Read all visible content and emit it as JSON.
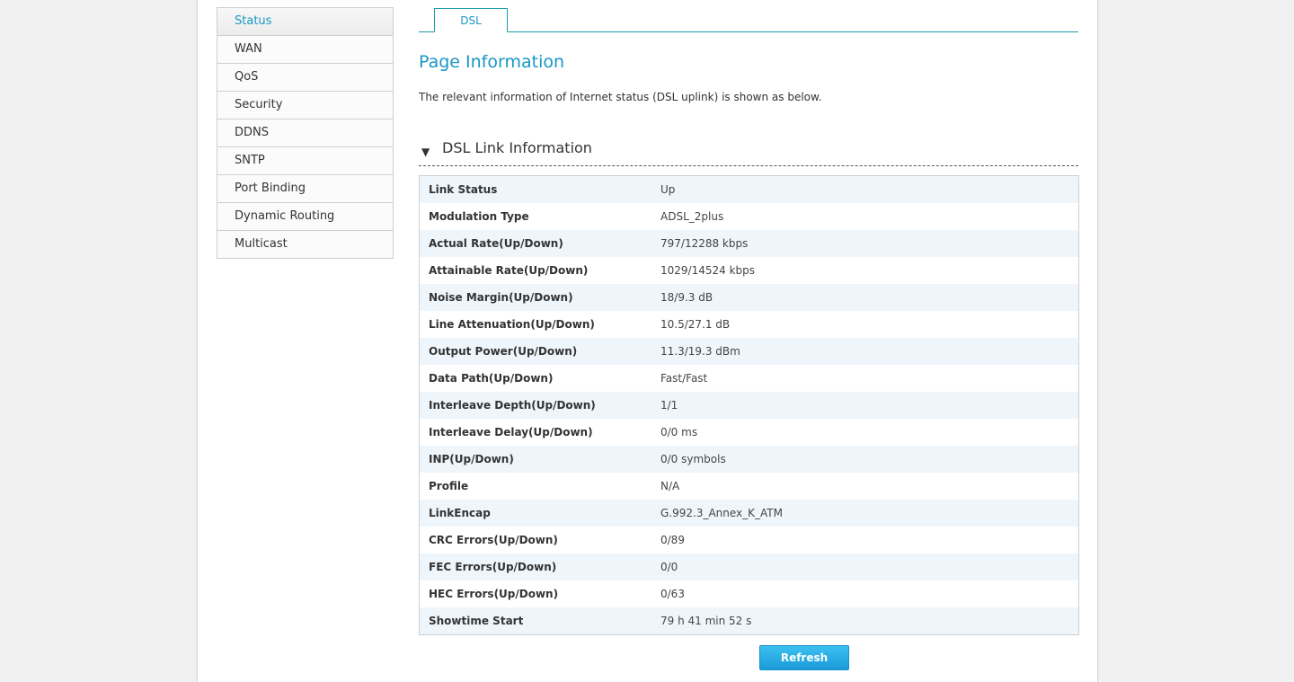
{
  "sidebar": {
    "items": [
      {
        "label": "Status",
        "active": true
      },
      {
        "label": "WAN"
      },
      {
        "label": "QoS"
      },
      {
        "label": "Security"
      },
      {
        "label": "DDNS"
      },
      {
        "label": "SNTP"
      },
      {
        "label": "Port Binding"
      },
      {
        "label": "Dynamic Routing"
      },
      {
        "label": "Multicast"
      }
    ]
  },
  "tabs": [
    {
      "label": "DSL",
      "active": true
    }
  ],
  "main": {
    "page_title": "Page Information",
    "description": "The relevant information of Internet status (DSL uplink) is shown as below.",
    "section_title": "DSL Link Information",
    "section_icon": "triangle-down-icon",
    "rows": [
      {
        "label": "Link Status",
        "value": "Up"
      },
      {
        "label": "Modulation Type",
        "value": "ADSL_2plus"
      },
      {
        "label": "Actual Rate(Up/Down)",
        "value": "797/12288 kbps"
      },
      {
        "label": "Attainable Rate(Up/Down)",
        "value": "1029/14524 kbps"
      },
      {
        "label": "Noise Margin(Up/Down)",
        "value": "18/9.3 dB"
      },
      {
        "label": "Line Attenuation(Up/Down)",
        "value": "10.5/27.1 dB"
      },
      {
        "label": "Output Power(Up/Down)",
        "value": "11.3/19.3 dBm"
      },
      {
        "label": "Data Path(Up/Down)",
        "value": "Fast/Fast"
      },
      {
        "label": "Interleave Depth(Up/Down)",
        "value": "1/1"
      },
      {
        "label": "Interleave Delay(Up/Down)",
        "value": "0/0 ms"
      },
      {
        "label": "INP(Up/Down)",
        "value": "0/0 symbols"
      },
      {
        "label": "Profile",
        "value": "N/A"
      },
      {
        "label": "LinkEncap",
        "value": "G.992.3_Annex_K_ATM"
      },
      {
        "label": "CRC Errors(Up/Down)",
        "value": "0/89"
      },
      {
        "label": "FEC Errors(Up/Down)",
        "value": "0/0"
      },
      {
        "label": "HEC Errors(Up/Down)",
        "value": "0/63"
      },
      {
        "label": "Showtime Start",
        "value": "79 h 41 min 52 s"
      }
    ],
    "refresh_label": "Refresh"
  },
  "colors": {
    "accent": "#1996c6",
    "tab_border": "#1a9aa8",
    "row_stripe": "#eef6fc",
    "button": "#1a9ad8"
  }
}
